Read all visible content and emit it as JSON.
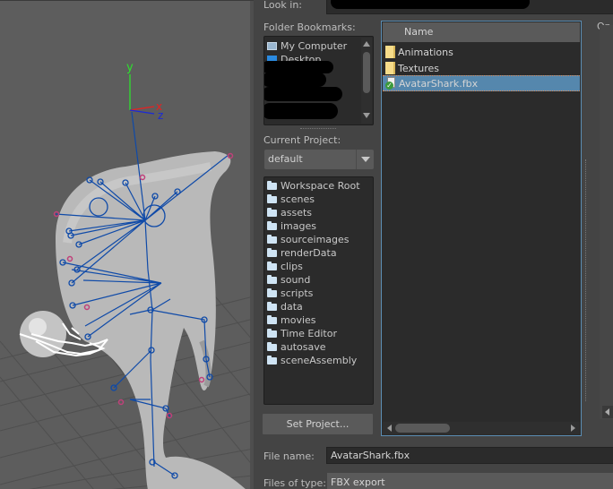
{
  "viewport": {
    "axis_labels": {
      "x": "x",
      "y": "y",
      "z": "z"
    },
    "colors": {
      "x_axis": "#e82020",
      "y_axis": "#2ee02e",
      "z_axis": "#1a2ad8",
      "bones": "#0f4aa8",
      "effectors": "#c0407a",
      "background": "#5d5d5d"
    }
  },
  "dialog": {
    "look_in_label": "Look in:",
    "look_in_value": "",
    "bookmarks": {
      "label": "Folder Bookmarks:",
      "items": [
        {
          "label": "My Computer",
          "icon": "computer-icon"
        },
        {
          "label": "Desktop",
          "icon": "desktop-icon"
        }
      ]
    },
    "current_project": {
      "label": "Current Project:",
      "selected": "default"
    },
    "project_folders": [
      "Workspace Root",
      "scenes",
      "assets",
      "images",
      "sourceimages",
      "renderData",
      "clips",
      "sound",
      "scripts",
      "data",
      "movies",
      "Time Editor",
      "autosave",
      "sceneAssembly"
    ],
    "set_project_label": "Set Project...",
    "files": {
      "column_name": "Name",
      "rows": [
        {
          "name": "Animations",
          "type": "folder",
          "selected": false
        },
        {
          "name": "Textures",
          "type": "folder",
          "selected": false
        },
        {
          "name": "AvatarShark.fbx",
          "type": "fbx-file",
          "selected": true
        }
      ]
    },
    "options_label": "Op",
    "file_name_label": "File name:",
    "file_name_value": "AvatarShark.fbx",
    "files_of_type_label": "Files of type:",
    "files_of_type_value": "FBX export",
    "accent": "#5587ad"
  }
}
